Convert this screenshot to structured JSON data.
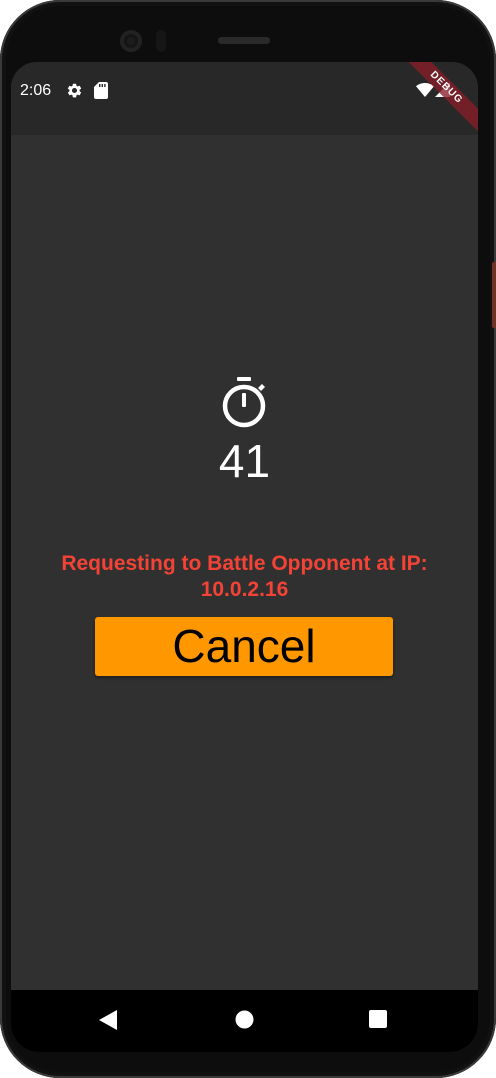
{
  "status_bar": {
    "time": "2:06",
    "icons": [
      "settings-gear-icon",
      "sd-card-icon",
      "wifi-icon",
      "cellular-signal-icon"
    ],
    "debug_banner": "DEBUG"
  },
  "main": {
    "timer_icon": "timer-icon",
    "countdown": "41",
    "request_line1": "Requesting to Battle Opponent at IP:",
    "request_line2": "10.0.2.16",
    "cancel_label": "Cancel"
  },
  "nav_bar": {
    "icons": [
      "back-icon",
      "home-icon",
      "recents-icon"
    ]
  },
  "colors": {
    "background": "#303030",
    "status_bar": "#282828",
    "accent_button": "#ff9800",
    "request_text": "#f44336",
    "debug_ribbon": "#881e28"
  }
}
